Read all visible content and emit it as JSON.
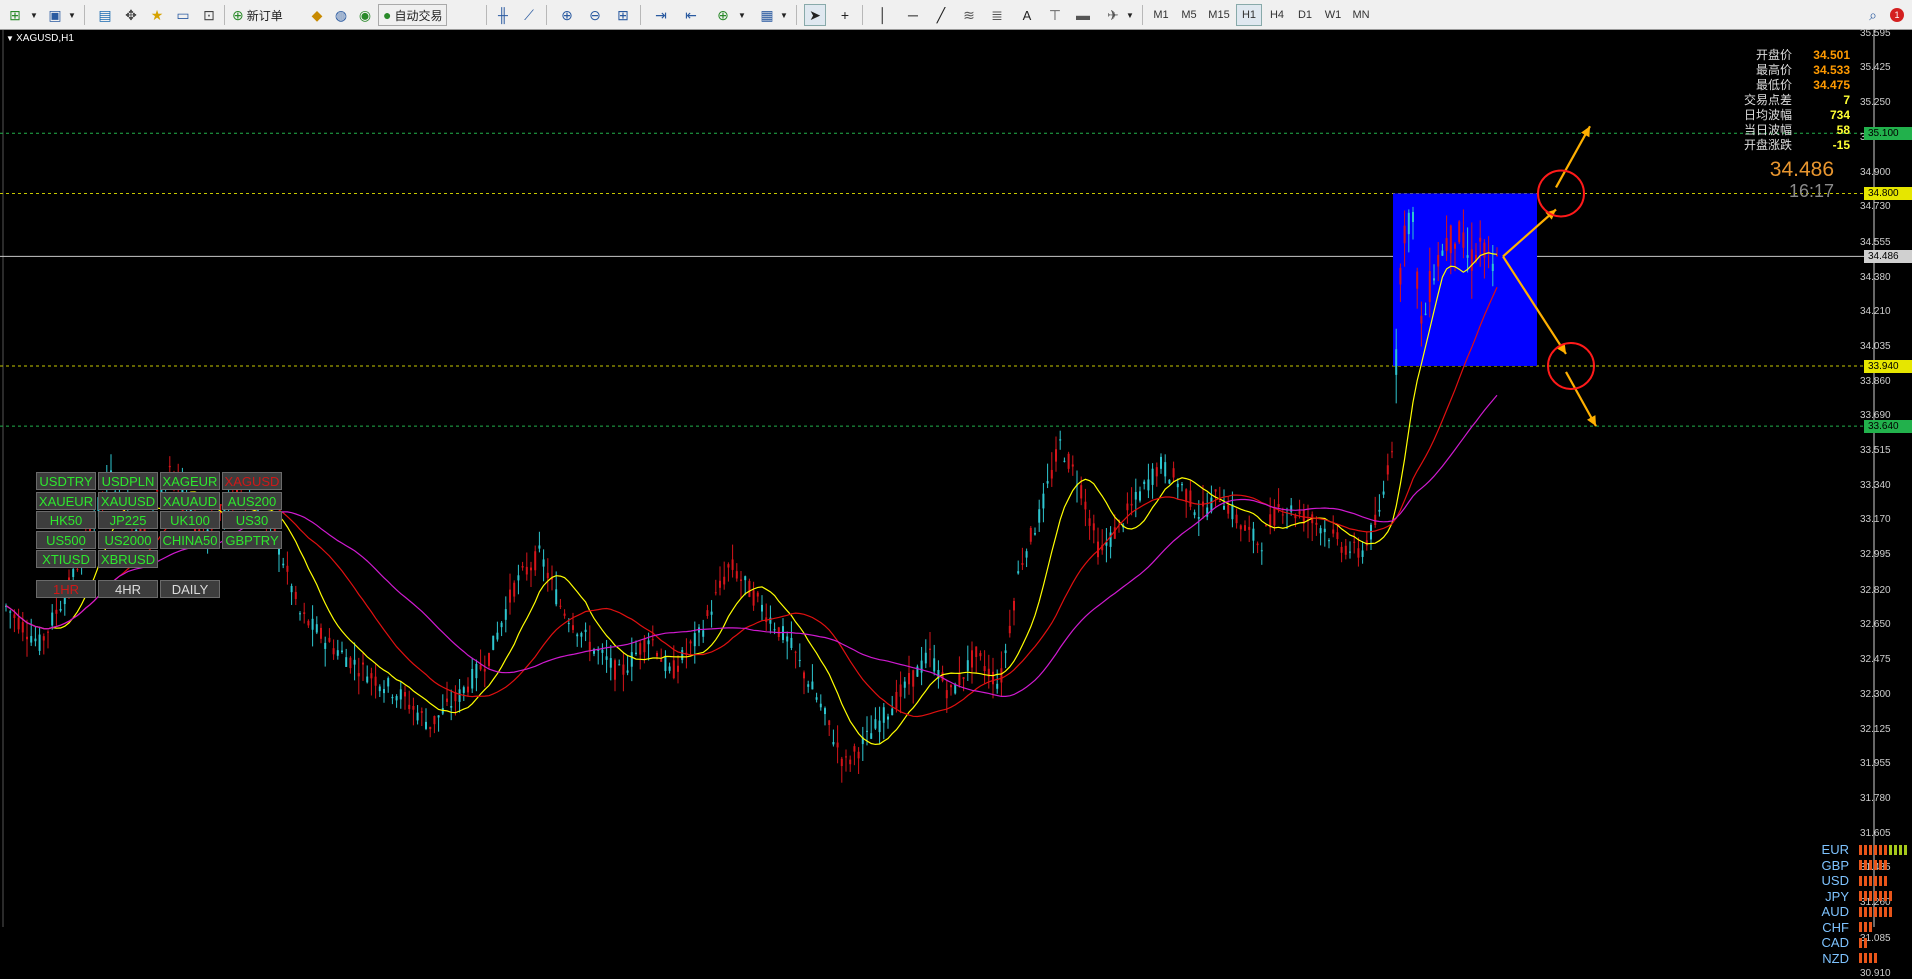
{
  "toolbar": {
    "new_order_label": "新订单",
    "auto_trade_label": "自动交易",
    "timeframes": [
      "M1",
      "M5",
      "M15",
      "H1",
      "H4",
      "D1",
      "W1",
      "MN"
    ],
    "active_timeframe": "H1"
  },
  "chart": {
    "symbol_title": "XAGUSD,H1",
    "current_price": "34.486",
    "countdown": "16:17",
    "colors": {
      "bull_candle": "#2ec6d0",
      "bear_candle": "#d6141a",
      "ma_fast": "#ffff00",
      "ma_mid": "#e01010",
      "ma_slow": "#d01ad0",
      "zone_box": "#0000ff",
      "level_line_green": "#22b14c",
      "level_line_yellow": "#c8c800",
      "arrow": "#ffb000",
      "circle": "#ff1a1a"
    }
  },
  "info_panel": [
    {
      "label": "开盘价",
      "value": "34.501",
      "color": "#ff9a00"
    },
    {
      "label": "最高价",
      "value": "34.533",
      "color": "#ff9a00"
    },
    {
      "label": "最低价",
      "value": "34.475",
      "color": "#ff9a00"
    },
    {
      "label": "交易点差",
      "value": "7",
      "color": "#ffff33"
    },
    {
      "label": "日均波幅",
      "value": "734",
      "color": "#ffff33"
    },
    {
      "label": "当日波幅",
      "value": "58",
      "color": "#ffff33"
    },
    {
      "label": "开盘涨跌",
      "value": "-15",
      "color": "#ffff33"
    }
  ],
  "price_axis": {
    "ticks": [
      "35.595",
      "35.425",
      "35.250",
      "35.075",
      "34.900",
      "34.730",
      "34.555",
      "34.380",
      "34.210",
      "34.035",
      "33.860",
      "33.690",
      "33.515",
      "33.340",
      "33.170",
      "32.995",
      "32.820",
      "32.650",
      "32.475",
      "32.300",
      "32.125",
      "31.955",
      "31.780",
      "31.605",
      "31.435",
      "31.260",
      "31.085",
      "30.910"
    ],
    "tag_levels": [
      {
        "text": "35.100",
        "bg": "#22b14c"
      },
      {
        "text": "34.800",
        "bg": "#e6e600"
      },
      {
        "text": "34.486",
        "bg": "#d0d0d0"
      },
      {
        "text": "33.940",
        "bg": "#e6e600"
      },
      {
        "text": "33.640",
        "bg": "#22b14c"
      }
    ]
  },
  "symbol_buttons": [
    [
      "USDTRY",
      "USDPLN",
      "XAGEUR",
      "XAGUSD"
    ],
    [
      "XAUEUR",
      "XAUUSD",
      "XAUAUD",
      "AUS200"
    ],
    [
      "HK50",
      "JP225",
      "UK100",
      "US30"
    ],
    [
      "US500",
      "US2000",
      "CHINA50",
      "GBPTRY"
    ],
    [
      "XTIUSD",
      "XBRUSD"
    ],
    [
      "1HR",
      "4HR",
      "DAILY"
    ]
  ],
  "currency_strength": [
    {
      "name": "EUR",
      "bars": 10,
      "yellow": 4
    },
    {
      "name": "GBP",
      "bars": 6,
      "yellow": 0
    },
    {
      "name": "USD",
      "bars": 6,
      "yellow": 0
    },
    {
      "name": "JPY",
      "bars": 7,
      "yellow": 0
    },
    {
      "name": "AUD",
      "bars": 7,
      "yellow": 0
    },
    {
      "name": "CHF",
      "bars": 3,
      "yellow": 0
    },
    {
      "name": "CAD",
      "bars": 2,
      "yellow": 0
    },
    {
      "name": "NZD",
      "bars": 4,
      "yellow": 0
    }
  ]
}
